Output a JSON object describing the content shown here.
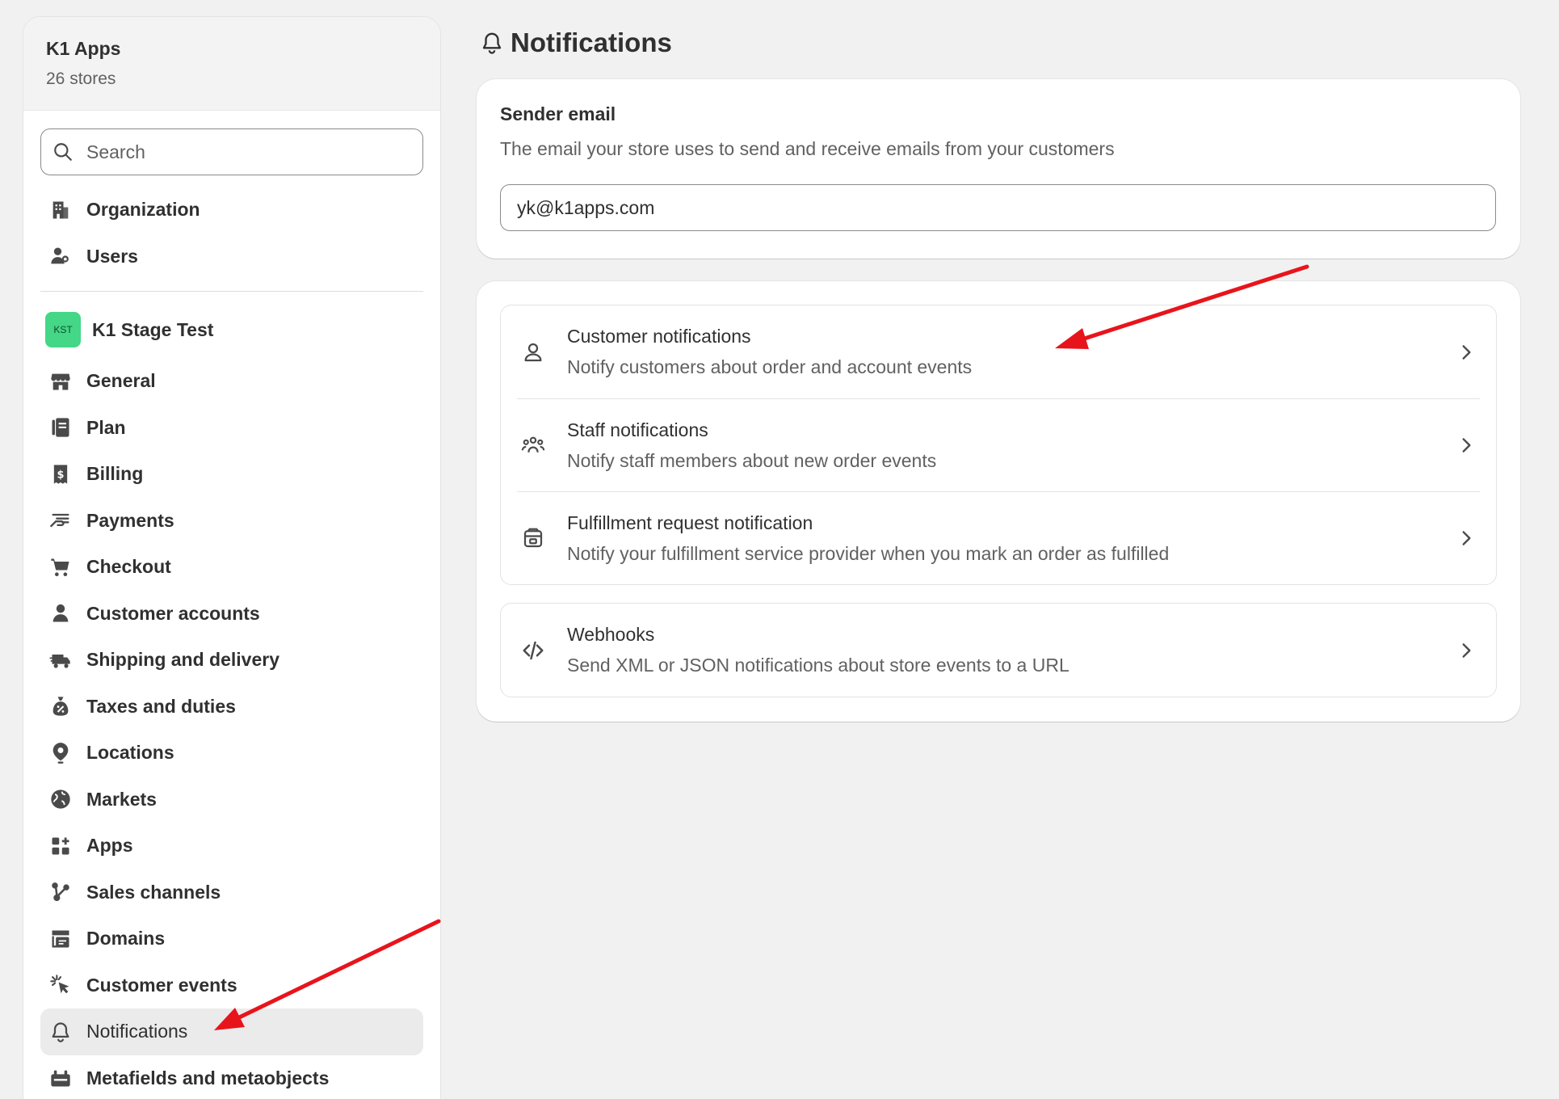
{
  "sidebar": {
    "org_name": "K1 Apps",
    "org_sub": "26 stores",
    "search_placeholder": "Search",
    "top_items": [
      {
        "label": "Organization",
        "icon": "building-icon"
      },
      {
        "label": "Users",
        "icon": "users-icon"
      }
    ],
    "store": {
      "badge": "KST",
      "name": "K1 Stage Test"
    },
    "items": [
      {
        "label": "General",
        "icon": "store-icon"
      },
      {
        "label": "Plan",
        "icon": "plan-icon"
      },
      {
        "label": "Billing",
        "icon": "billing-icon"
      },
      {
        "label": "Payments",
        "icon": "payments-icon"
      },
      {
        "label": "Checkout",
        "icon": "cart-icon"
      },
      {
        "label": "Customer accounts",
        "icon": "person-icon"
      },
      {
        "label": "Shipping and delivery",
        "icon": "truck-icon"
      },
      {
        "label": "Taxes and duties",
        "icon": "tax-icon"
      },
      {
        "label": "Locations",
        "icon": "location-pin-icon"
      },
      {
        "label": "Markets",
        "icon": "globe-icon"
      },
      {
        "label": "Apps",
        "icon": "apps-icon"
      },
      {
        "label": "Sales channels",
        "icon": "sales-channels-icon"
      },
      {
        "label": "Domains",
        "icon": "domains-icon"
      },
      {
        "label": "Customer events",
        "icon": "cursor-click-icon"
      },
      {
        "label": "Notifications",
        "icon": "bell-icon",
        "active": true
      },
      {
        "label": "Metafields and metaobjects",
        "icon": "metafields-icon"
      }
    ]
  },
  "main": {
    "title": "Notifications",
    "sender": {
      "title": "Sender email",
      "description": "The email your store uses to send and receive emails from your customers",
      "email": "yk@k1apps.com"
    },
    "groups": [
      [
        {
          "title": "Customer notifications",
          "description": "Notify customers about order and account events",
          "icon": "person-outline-icon"
        },
        {
          "title": "Staff notifications",
          "description": "Notify staff members about new order events",
          "icon": "staff-group-icon"
        },
        {
          "title": "Fulfillment request notification",
          "description": "Notify your fulfillment service provider when you mark an order as fulfilled",
          "icon": "fulfillment-box-icon"
        }
      ],
      [
        {
          "title": "Webhooks",
          "description": "Send XML or JSON notifications about store events to a URL",
          "icon": "code-icon"
        }
      ]
    ]
  },
  "annotation_color": "#e8141c"
}
